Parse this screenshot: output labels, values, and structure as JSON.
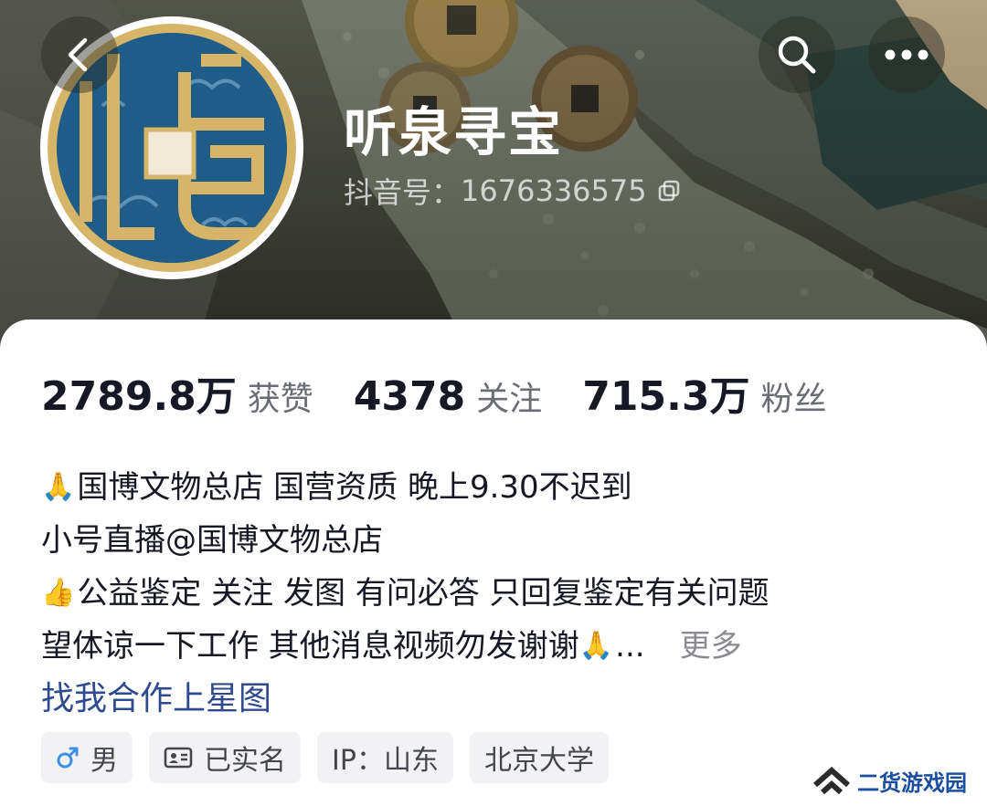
{
  "header": {
    "display_name": "听泉寻宝",
    "id_label": "抖音号：",
    "id_value": "1676336575"
  },
  "icons": {
    "back": "chevron-left-icon",
    "search": "search-icon",
    "more": "more-horizontal-icon",
    "copy": "copy-icon",
    "male": "male-icon",
    "verified": "id-card-icon"
  },
  "stats": {
    "likes_value": "2789.8万",
    "likes_label": "获赞",
    "following_value": "4378",
    "following_label": "关注",
    "followers_value": "715.3万",
    "followers_label": "粉丝"
  },
  "bio": {
    "line1_emoji": "🙏",
    "line1_text": "国博文物总店 国营资质 晚上9.30不迟到",
    "line2_text": "小号直播@国博文物总店",
    "line3_emoji": "👍",
    "line3_text": "公益鉴定 关注 发图 有问必答 只回复鉴定有关问题",
    "line4_text": "望体谅一下工作 其他消息视频勿发谢谢",
    "line4_emoji": "🙏",
    "line4_ellipsis": "...",
    "more_label": "更多",
    "star_link": "找我合作上星图"
  },
  "tags": {
    "gender": "男",
    "verified": "已实名",
    "ip": "IP：山东",
    "school": "北京大学"
  },
  "watermark": {
    "text": "二货游戏园"
  },
  "colors": {
    "accent_link": "#2f4b8f",
    "text_primary": "#161823",
    "text_secondary": "#6b6d75",
    "tag_bg": "#f2f2f4",
    "avatar_blue": "#1f5c87",
    "avatar_gold": "#d6b468",
    "male_blue": "#3d8fe0"
  }
}
